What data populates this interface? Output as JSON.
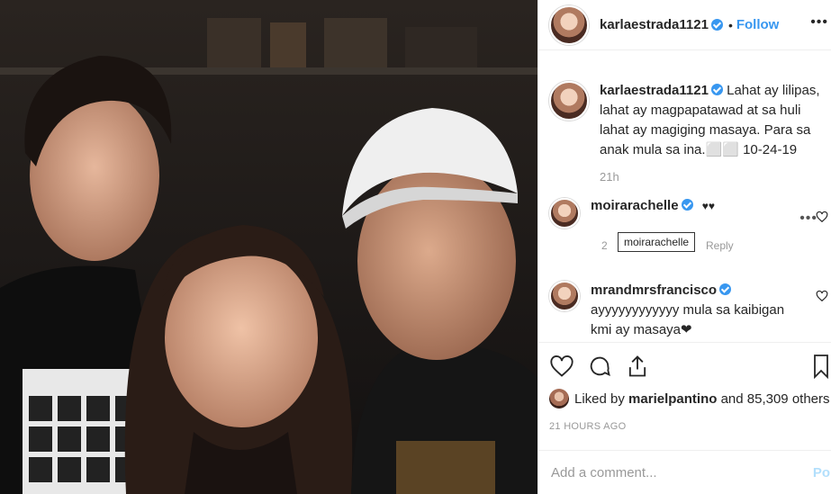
{
  "post": {
    "username": "karlaestrada1121",
    "follow_label": "Follow",
    "separator": "•",
    "more_icon": "•••"
  },
  "caption": {
    "username": "karlaestrada1121",
    "text": "Lahat ay lilipas, lahat ay magpapatawad at sa huli lahat ay magiging masaya. Para sa anak mula sa ina.⬜⬜ 10-24-19",
    "time": "21h"
  },
  "comments": [
    {
      "username": "moirarachelle",
      "text": "♥♥",
      "meta": "2",
      "tooltip": "moirarachelle",
      "reply": "Reply",
      "options": "•••"
    },
    {
      "username": "mrandmrsfrancisco",
      "text": "ayyyyyyyyyyyy mula sa kaibigan kmi ay masaya❤"
    }
  ],
  "likes": {
    "prefix": "Liked by",
    "user": "marielpantino",
    "suffix": "and 85,309 others"
  },
  "timestamp": "21 HOURS AGO",
  "add_comment": {
    "placeholder": "Add a comment...",
    "post_label": "Po"
  },
  "colors": {
    "link": "#3897f0",
    "muted": "#999999",
    "post_disabled": "#b2dffc"
  }
}
